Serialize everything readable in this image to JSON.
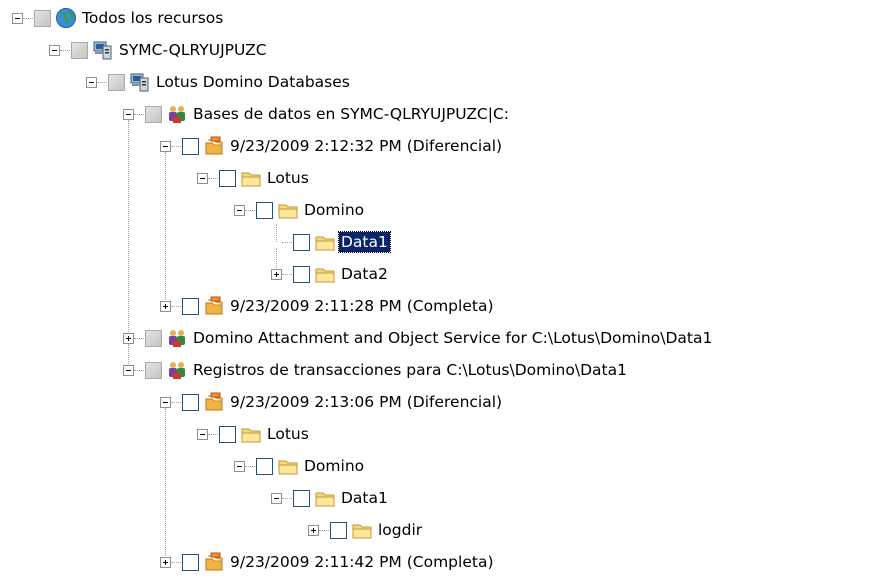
{
  "tree": [
    {
      "label": "Todos los recursos",
      "icon": "globe-icon",
      "expander": "minus",
      "check": "grey",
      "selected": false
    },
    {
      "label": "SYMC-QLRYUJPUZC",
      "icon": "server-icon",
      "expander": "minus",
      "check": "grey",
      "selected": false
    },
    {
      "label": "Lotus Domino Databases",
      "icon": "server-icon",
      "expander": "minus",
      "check": "grey",
      "selected": false
    },
    {
      "label": "Bases de datos en SYMC-QLRYUJPUZC|C:",
      "icon": "people-icon",
      "expander": "minus",
      "check": "grey",
      "selected": false
    },
    {
      "label": "9/23/2009 2:12:32 PM (Diferencial)",
      "icon": "backup-set-icon",
      "expander": "minus",
      "check": "empty",
      "selected": false
    },
    {
      "label": "Lotus",
      "icon": "folder-icon",
      "expander": "minus",
      "check": "empty",
      "selected": false
    },
    {
      "label": "Domino",
      "icon": "folder-icon",
      "expander": "minus",
      "check": "empty",
      "selected": false
    },
    {
      "label": "Data1",
      "icon": "folder-icon",
      "expander": "none",
      "check": "empty",
      "selected": true
    },
    {
      "label": "Data2",
      "icon": "folder-icon",
      "expander": "plus",
      "check": "empty",
      "selected": false
    },
    {
      "label": "9/23/2009 2:11:28 PM (Completa)",
      "icon": "backup-set-icon",
      "expander": "plus",
      "check": "empty",
      "selected": false
    },
    {
      "label": "Domino Attachment and Object Service for C:\\Lotus\\Domino\\Data1",
      "icon": "people-icon",
      "expander": "plus",
      "check": "grey",
      "selected": false
    },
    {
      "label": "Registros de transacciones para C:\\Lotus\\Domino\\Data1",
      "icon": "people-icon",
      "expander": "minus",
      "check": "grey",
      "selected": false
    },
    {
      "label": "9/23/2009 2:13:06 PM (Diferencial)",
      "icon": "backup-set-icon",
      "expander": "minus",
      "check": "empty",
      "selected": false
    },
    {
      "label": "Lotus",
      "icon": "folder-icon",
      "expander": "minus",
      "check": "empty",
      "selected": false
    },
    {
      "label": "Domino",
      "icon": "folder-icon",
      "expander": "minus",
      "check": "empty",
      "selected": false
    },
    {
      "label": "Data1",
      "icon": "folder-icon",
      "expander": "minus",
      "check": "empty",
      "selected": false
    },
    {
      "label": "logdir",
      "icon": "folder-icon",
      "expander": "plus",
      "check": "empty",
      "selected": false
    },
    {
      "label": "9/23/2009 2:11:42 PM (Completa)",
      "icon": "backup-set-icon",
      "expander": "plus",
      "check": "empty",
      "selected": false
    }
  ]
}
